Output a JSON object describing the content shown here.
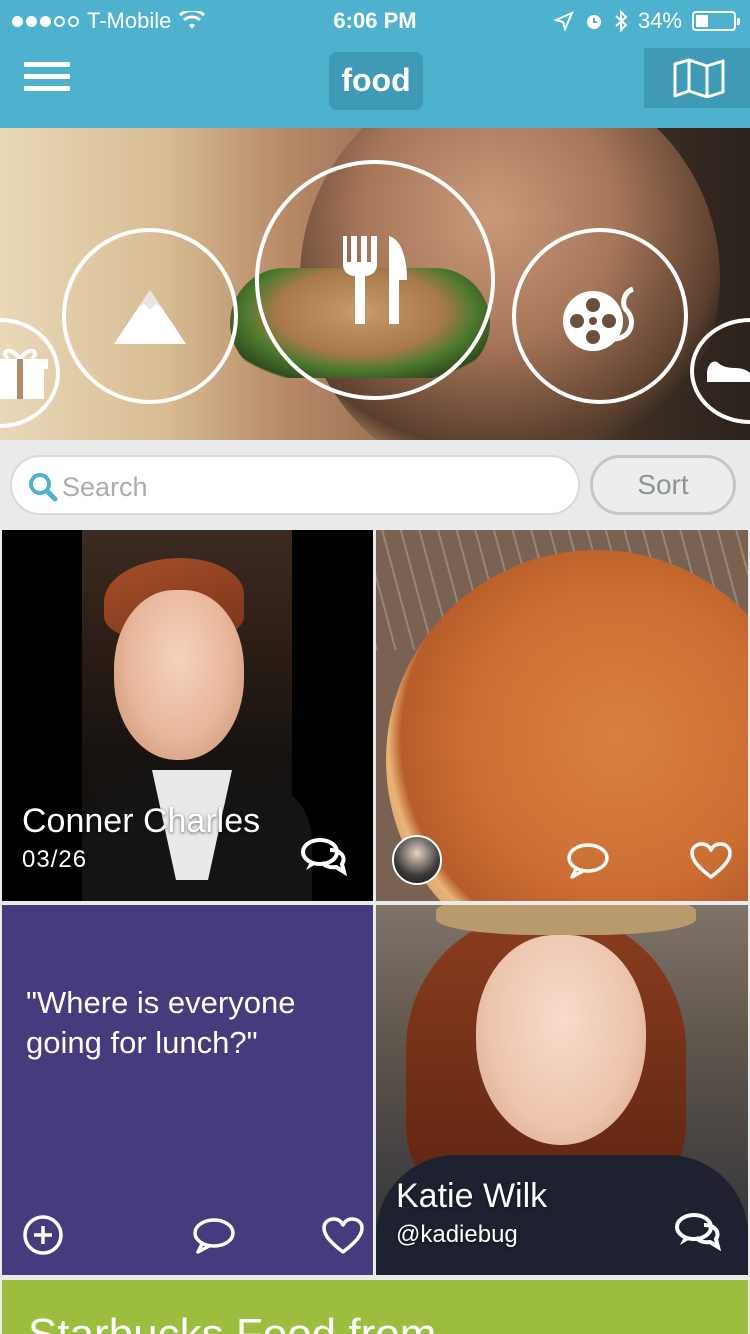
{
  "status_bar": {
    "carrier": "T-Mobile",
    "time": "6:06 PM",
    "battery_text": "34%",
    "battery_level": 0.34
  },
  "nav": {
    "title": "food",
    "menu_icon": "hamburger-menu-icon",
    "map_icon": "map-icon"
  },
  "categories": [
    {
      "icon": "gift-icon",
      "selected": false
    },
    {
      "icon": "mountain-icon",
      "selected": false
    },
    {
      "icon": "fork-knife-icon",
      "selected": true
    },
    {
      "icon": "film-reel-icon",
      "selected": false
    },
    {
      "icon": "shoe-icon",
      "selected": false
    }
  ],
  "search": {
    "placeholder": "Search"
  },
  "sort_label": "Sort",
  "feed": {
    "tile1": {
      "name": "Conner Charles",
      "date": "03/26"
    },
    "tile3": {
      "quote": "\"Where is everyone going for lunch?\""
    },
    "tile4": {
      "name": "Katie Wilk",
      "handle": "@kadiebug"
    },
    "tile5": {
      "title": "Starbucks Food from"
    }
  },
  "colors": {
    "header": "#4eb2cf",
    "header_chip": "#3f9ab5",
    "quote_tile": "#463b7c"
  }
}
